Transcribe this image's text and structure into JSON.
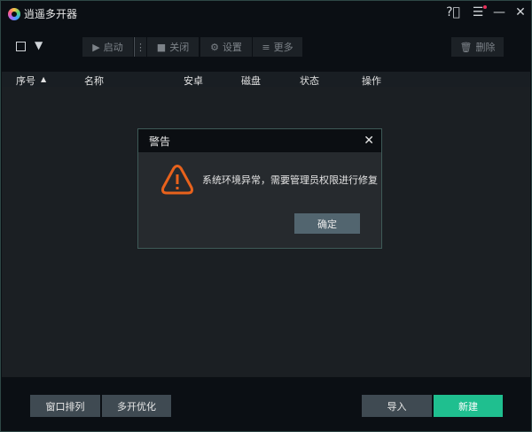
{
  "app": {
    "title": "逍遥多开器"
  },
  "toolbar": {
    "start": "启动",
    "close": "关闭",
    "settings": "设置",
    "more": "更多",
    "delete": "删除"
  },
  "table": {
    "columns": [
      "序号",
      "名称",
      "安卓",
      "磁盘",
      "状态",
      "操作"
    ]
  },
  "dialog": {
    "title": "警告",
    "message": "系统环境异常，需要管理员权限进行修复",
    "ok": "确定"
  },
  "footer": {
    "arrange": "窗口排列",
    "optimize": "多开优化",
    "import": "导入",
    "create": "新建"
  },
  "colors": {
    "accent": "#1fbf8f",
    "warning": "#e8621c",
    "notify": "#e8305a"
  }
}
